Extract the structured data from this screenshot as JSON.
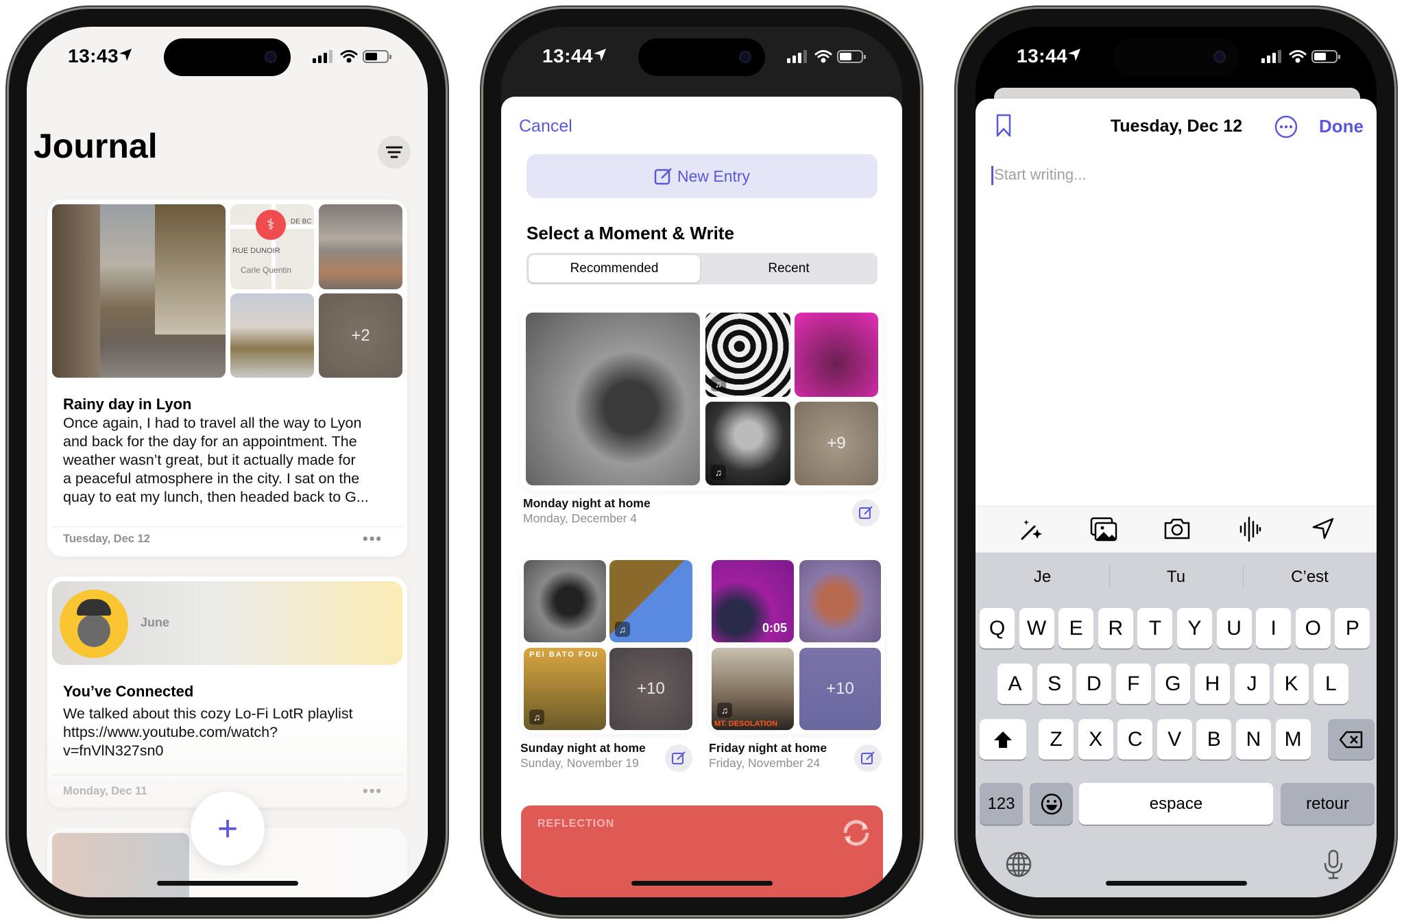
{
  "colors": {
    "accent": "#5a57d9",
    "reflection": "#e05a55",
    "keyboard": "#d1d3d9"
  },
  "phone1": {
    "status": {
      "time": "13:43",
      "icons": [
        "location-arrow-icon",
        "signal-icon",
        "wifi-icon",
        "battery-icon"
      ]
    },
    "title": "Journal",
    "filter_icon": "filter-icon",
    "entries": [
      {
        "title": "Rainy day in Lyon",
        "body": [
          "Once again, I had to travel all the way to Lyon",
          "and back for the day for an appointment. The",
          "weather wasn’t great, but it actually made for",
          "a peaceful atmosphere in the city. I sat on the",
          "quay to eat my lunch, then headed back to G..."
        ],
        "date": "Tuesday, Dec 12",
        "more_photos": "+2",
        "map_labels": [
          "DE BC",
          "RUE DUNOIR",
          "Carle Quentin"
        ]
      },
      {
        "title": "You’ve Connected",
        "contact": "June",
        "body": [
          "We talked about this cozy Lo-Fi LotR playlist",
          "https://www.youtube.com/watch?",
          "v=fnVlN327sn0"
        ],
        "date": "Monday, Dec 11"
      }
    ],
    "more_label": "•••",
    "add_label": "+"
  },
  "phone2": {
    "status": {
      "time": "13:44"
    },
    "cancel": "Cancel",
    "new_entry": "New Entry",
    "section_title": "Select a Moment & Write",
    "segments": [
      {
        "label": "Recommended",
        "selected": true
      },
      {
        "label": "Recent",
        "selected": false
      }
    ],
    "moments": [
      {
        "title": "Monday night at home",
        "date": "Monday, December 4",
        "more": "+9"
      },
      {
        "title": "Sunday night at home",
        "date": "Sunday, November 19",
        "more": "+10",
        "album": "PEI BATO FOU"
      },
      {
        "title": "Friday night at home",
        "date": "Friday, November 24",
        "more": "+10",
        "video_duration": "0:05",
        "album": "MT. DESOLATION"
      }
    ],
    "reflection": {
      "label": "REFLECTION"
    }
  },
  "phone3": {
    "status": {
      "time": "13:44"
    },
    "title": "Tuesday, Dec 12",
    "done": "Done",
    "placeholder": "Start writing...",
    "toolbar": [
      "magic-wand-icon",
      "photos-icon",
      "camera-icon",
      "audio-waveform-icon",
      "location-icon"
    ],
    "suggestions": [
      "Je",
      "Tu",
      "C’est"
    ],
    "keyboard": {
      "rows": [
        [
          "Q",
          "W",
          "E",
          "R",
          "T",
          "Y",
          "U",
          "I",
          "O",
          "P"
        ],
        [
          "A",
          "S",
          "D",
          "F",
          "G",
          "H",
          "J",
          "K",
          "L"
        ],
        [
          "Z",
          "X",
          "C",
          "V",
          "B",
          "N",
          "M"
        ]
      ],
      "numbers": "123",
      "space": "espace",
      "return": "retour"
    }
  }
}
